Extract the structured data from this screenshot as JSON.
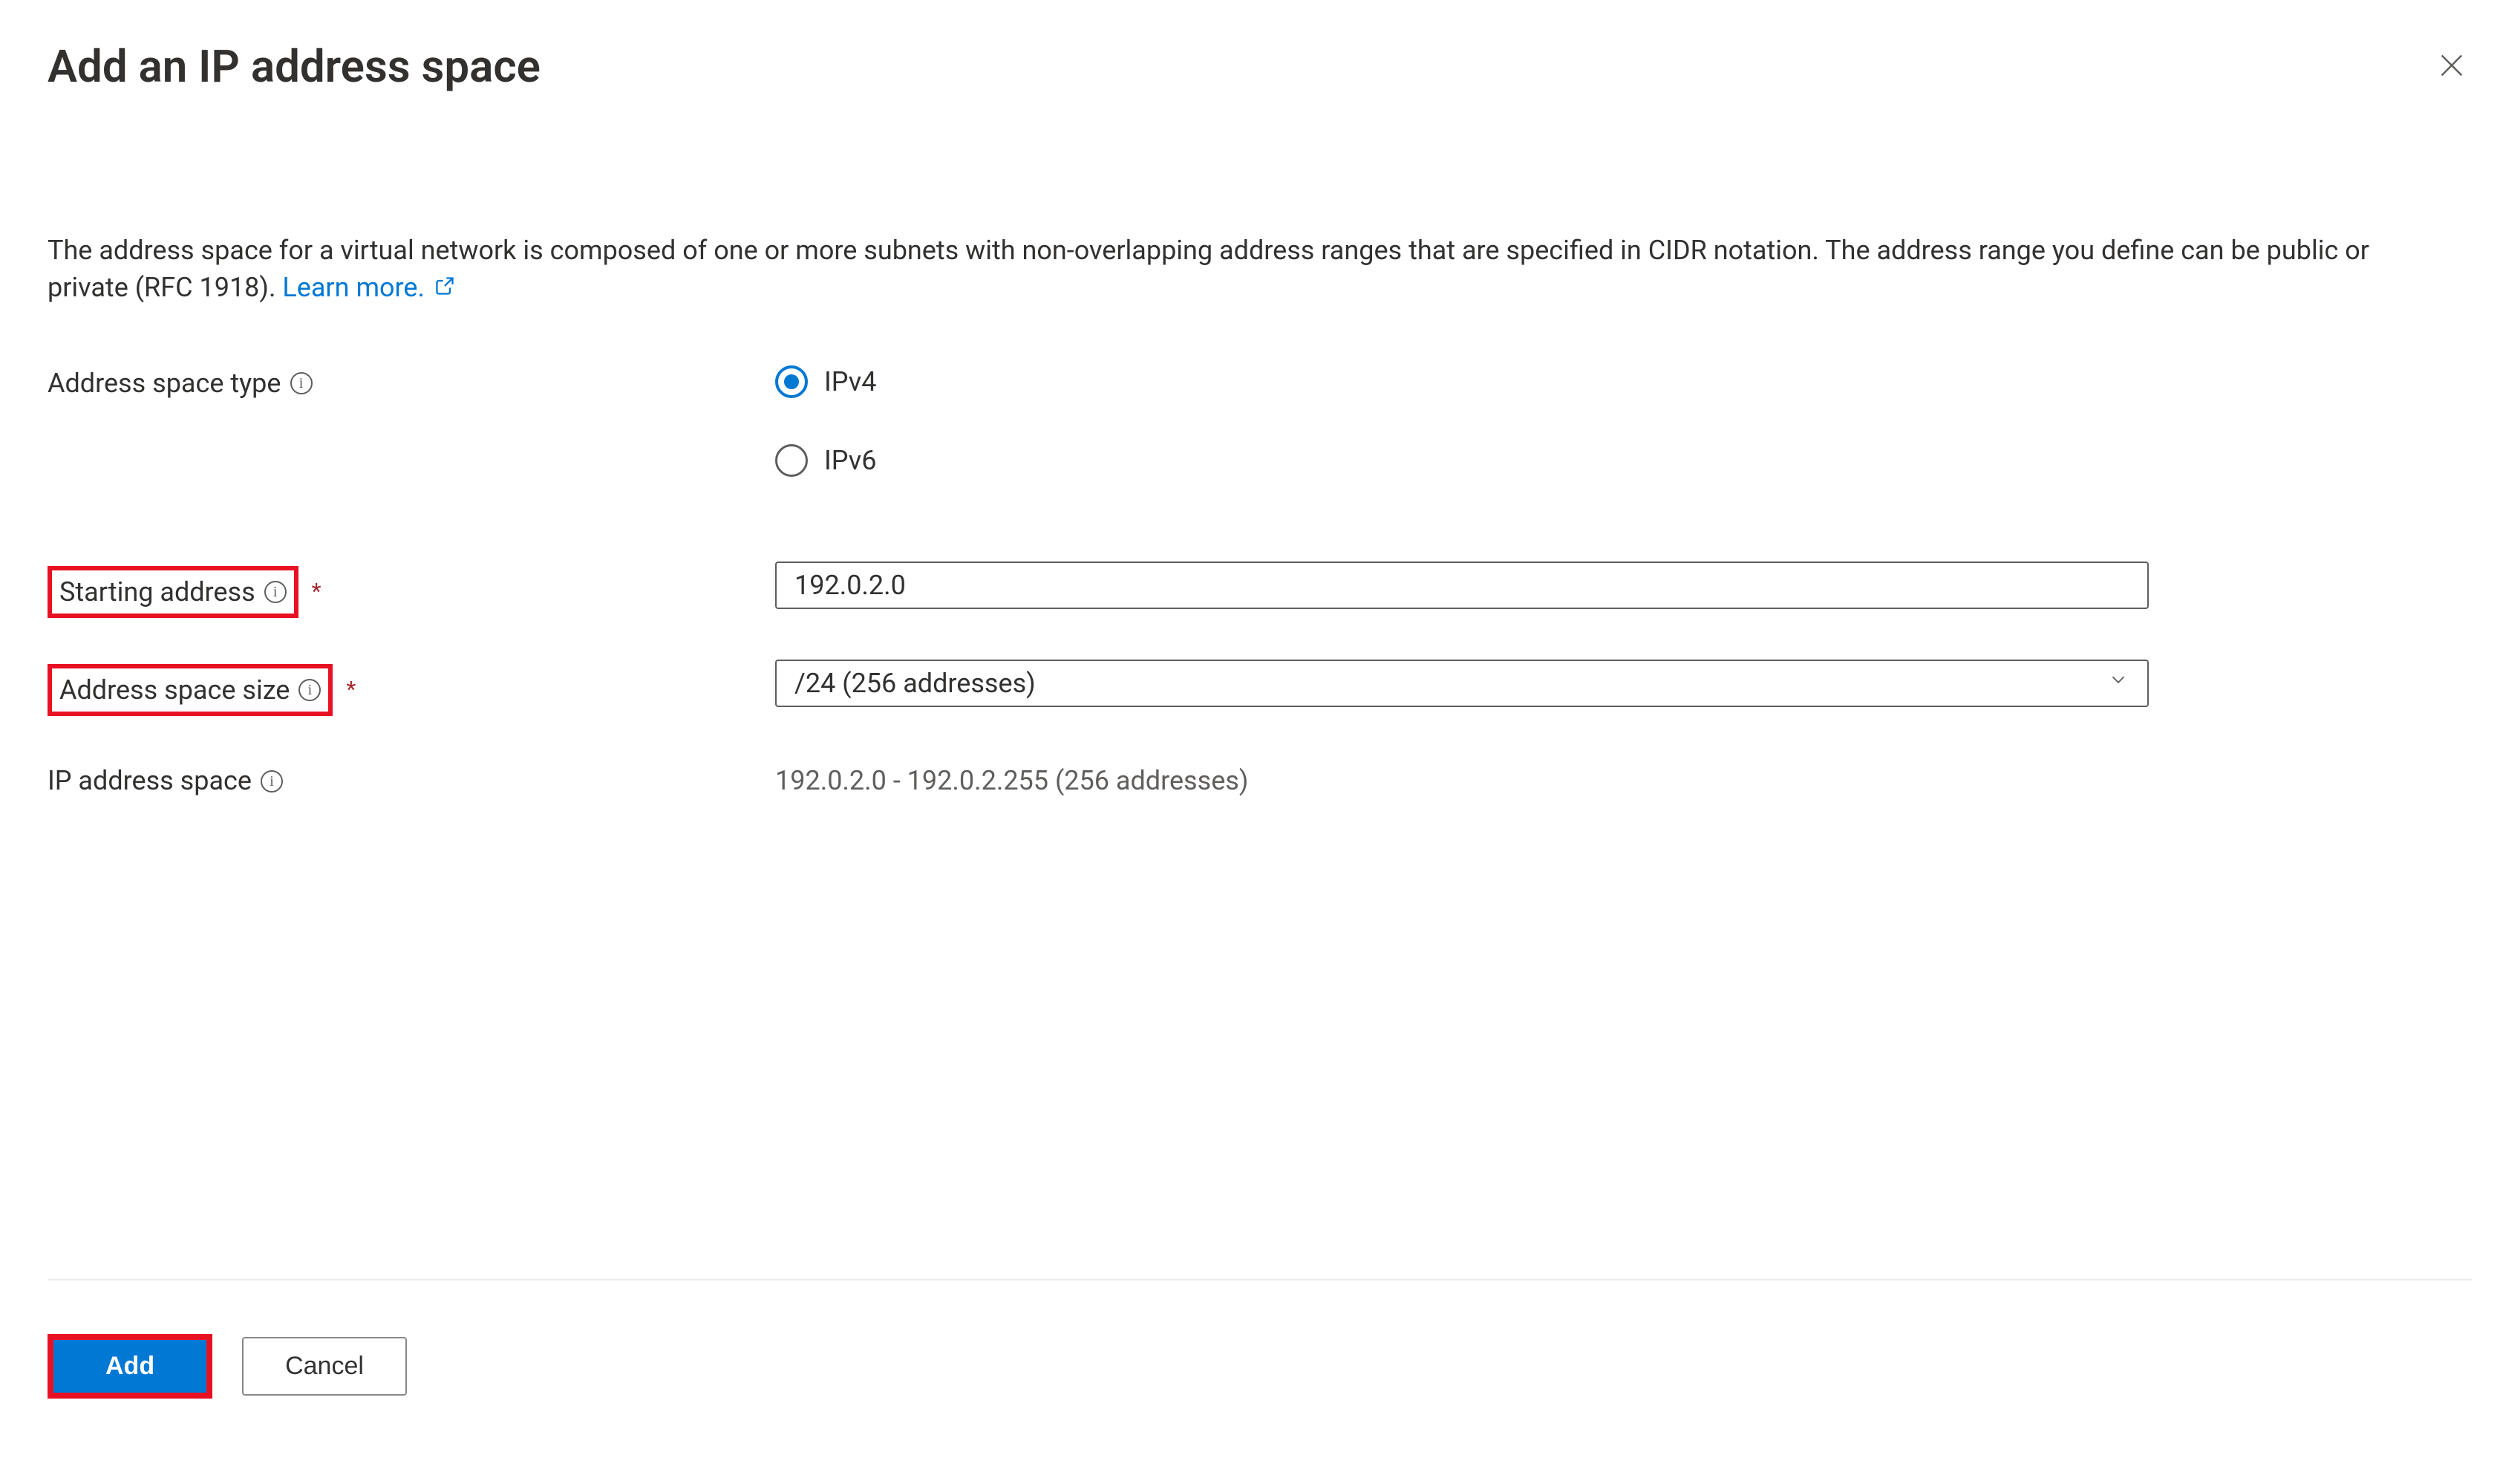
{
  "header": {
    "title": "Add an IP address space"
  },
  "description": {
    "text": "The address space for a virtual network is composed of one or more subnets with non-overlapping address ranges that are specified in CIDR notation. The address range you define can be public or private (RFC 1918). ",
    "learn_more_label": "Learn more."
  },
  "form": {
    "address_space_type": {
      "label": "Address space type",
      "options": {
        "ipv4": "IPv4",
        "ipv6": "IPv6"
      },
      "selected": "ipv4"
    },
    "starting_address": {
      "label": "Starting address",
      "value": "192.0.2.0"
    },
    "address_space_size": {
      "label": "Address space size",
      "selected": "/24 (256 addresses)"
    },
    "ip_address_space": {
      "label": "IP address space",
      "value": "192.0.2.0 - 192.0.2.255 (256 addresses)"
    }
  },
  "footer": {
    "add_label": "Add",
    "cancel_label": "Cancel"
  }
}
